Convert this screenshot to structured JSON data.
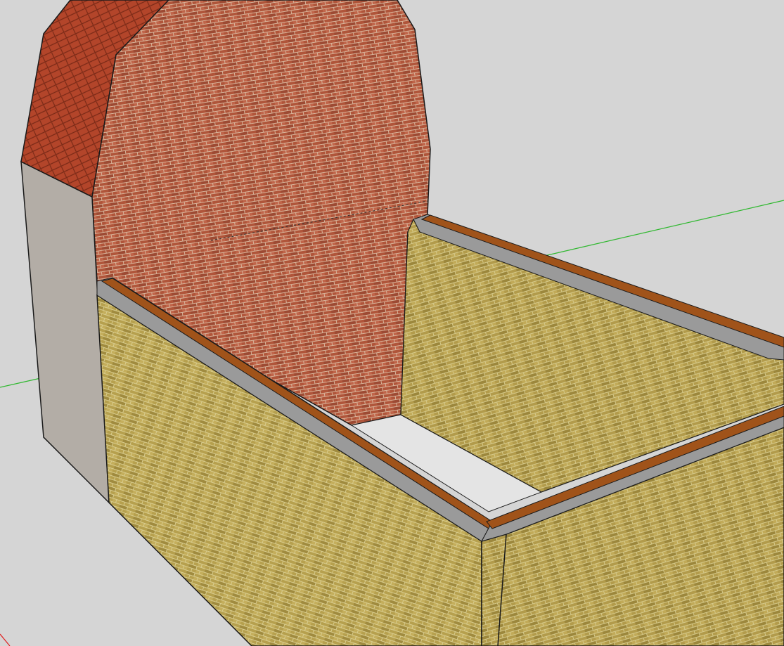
{
  "viewport": {
    "background": "#d5d5d5",
    "axis_colors": {
      "green": "#2fb82f",
      "red": "#e02020"
    }
  },
  "materials": {
    "red_brick": "#b0553a",
    "red_brick_mortar": "#d8b49a",
    "roof_tile": "#b3452a",
    "roof_tile_line": "#7a2a17",
    "yellow_brick": "#b6a04e",
    "yellow_brick_mortar": "#d8cc8e",
    "coping_stone": "#9a9a9a",
    "wood_beam": "#a0531a",
    "render_plaster": "#b3ada6",
    "floor": "#e4e4e4",
    "edge": "#1a1a1a"
  }
}
